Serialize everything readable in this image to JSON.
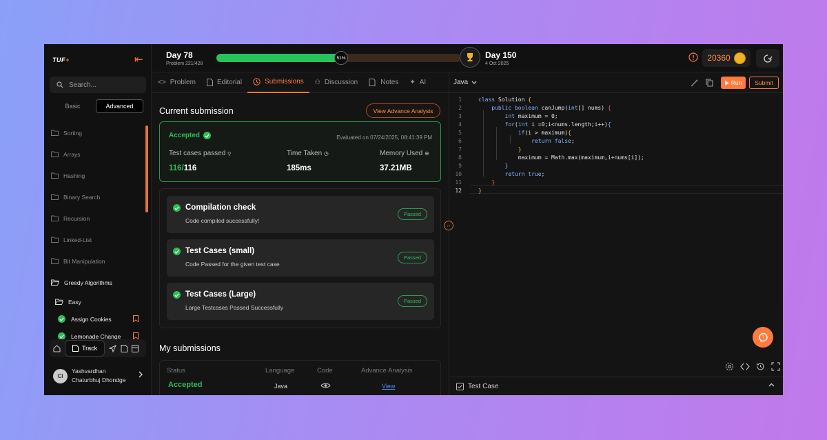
{
  "app": {
    "logo": "TUF",
    "logo_mark": "+"
  },
  "sidebar": {
    "search_placeholder": "Search...",
    "modes": [
      "Basic",
      "Advanced"
    ],
    "topics": [
      "Sorting",
      "Arrays",
      "Hashing",
      "Binary Search",
      "Recursion",
      "Linked-List",
      "Bit Manipulation"
    ],
    "open_topic": "Greedy Algorithms",
    "open_sub": "Easy",
    "problems": [
      "Assign Cookies",
      "Lemonade Change"
    ],
    "track_label": "Track",
    "user": {
      "initials": "CI",
      "name": "Yashvardhan Chaturbhuj Dhondge"
    }
  },
  "header": {
    "day_start": "Day 78",
    "problem_count": "Problem 221/428",
    "progress": 51,
    "progress_label": "51%",
    "day_end": "Day 150",
    "end_date": "4 Oct 2025",
    "coins": "20360"
  },
  "tabs": [
    "Problem",
    "Editorial",
    "Submissions",
    "Discussion",
    "Notes",
    "AI"
  ],
  "current": {
    "title": "Current submission",
    "advance_btn": "View Advance Analysis",
    "status": "Accepted",
    "evaluated": "Evaluated on 07/24/2025, 08:41:39 PM",
    "metrics": [
      {
        "label": "Test cases passed",
        "value_pass": "116/",
        "value_total": "116"
      },
      {
        "label": "Time Taken",
        "value": "185ms"
      },
      {
        "label": "Memory Used",
        "value": "37.21MB"
      }
    ],
    "checks": [
      {
        "title": "Compilation check",
        "sub": "Code compiled successfully!",
        "badge": "Passed"
      },
      {
        "title": "Test Cases (small)",
        "sub": "Code Passed for the given test case",
        "badge": "Passed"
      },
      {
        "title": "Test Cases (Large)",
        "sub": "Large Testcases Passed Successfully",
        "badge": "Passed"
      }
    ]
  },
  "my_submissions": {
    "title": "My submissions",
    "headers": [
      "Status",
      "Language",
      "Code",
      "Advance Analysis"
    ],
    "row": {
      "status": "Accepted",
      "language": "Java",
      "link": "View"
    }
  },
  "editor": {
    "language": "Java",
    "run": "Run",
    "submit": "Submit",
    "line_numbers": [
      "1",
      "2",
      "3",
      "4",
      "5",
      "6",
      "7",
      "8",
      "9",
      "10",
      "11",
      "12"
    ],
    "testcase_label": "Test Case"
  }
}
